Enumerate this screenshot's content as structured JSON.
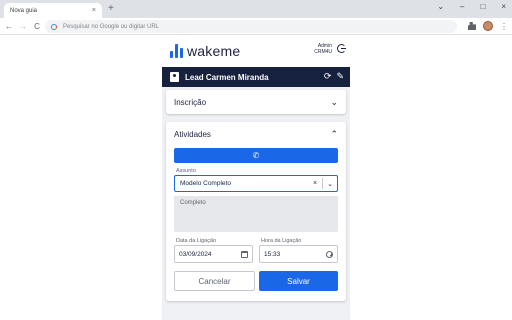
{
  "browser": {
    "tab_title": "Nova guia",
    "tab_close": "×",
    "new_tab": "+",
    "window_controls": [
      "⌄",
      "–",
      "□",
      "×"
    ],
    "nav": {
      "back": "←",
      "forward": "→",
      "reload": "C"
    },
    "omnibox_placeholder": "Pesquisar no Google ou digitar URL",
    "menu": "⋮"
  },
  "app": {
    "logo_text": "wakeme",
    "user_name": "Admin",
    "user_code": "CRM4U",
    "lead_title": "Lead Carmen Miranda",
    "lead_icons": {
      "sync": "⟳",
      "edit": "✎"
    },
    "sections": {
      "inscricao": {
        "title": "Inscrição",
        "chevron": "⌄"
      },
      "atividades": {
        "title": "Atividades",
        "chevron": "⌃"
      }
    },
    "call_button_icon": "✆",
    "assunto": {
      "label": "Assunto",
      "value": "Modelo Completo",
      "clear": "×",
      "chevron": "⌄"
    },
    "description": "Completo",
    "data_ligacao": {
      "label": "Data da Ligação",
      "value": "03/09/2024"
    },
    "hora_ligacao": {
      "label": "Hora da Ligação",
      "value": "15:33"
    },
    "buttons": {
      "cancel": "Cancelar",
      "save": "Salvar"
    }
  },
  "colors": {
    "primary": "#1a67e8",
    "dark_navy": "#16213d",
    "app_bg": "#eef0f3"
  }
}
